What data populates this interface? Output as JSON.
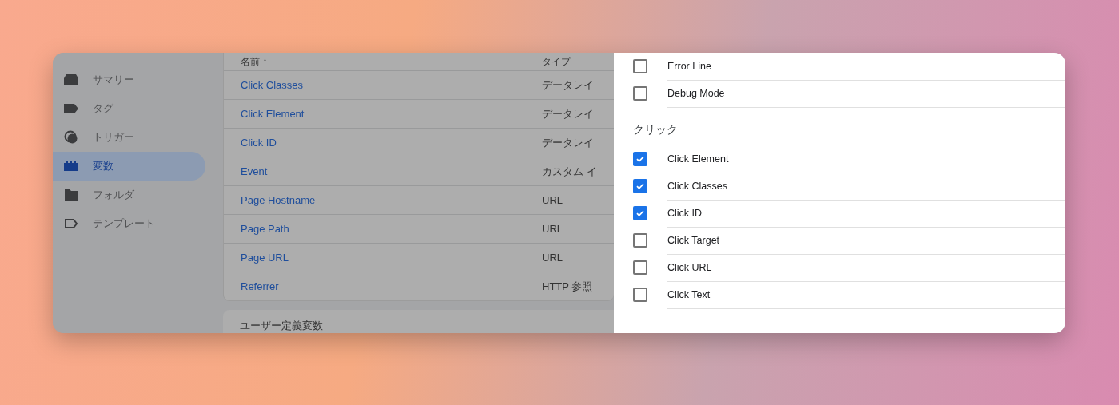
{
  "sidebar": {
    "items": [
      {
        "label": "サマリー",
        "selected": false
      },
      {
        "label": "タグ",
        "selected": false
      },
      {
        "label": "トリガー",
        "selected": false
      },
      {
        "label": "変数",
        "selected": true
      },
      {
        "label": "フォルダ",
        "selected": false
      },
      {
        "label": "テンプレート",
        "selected": false
      }
    ]
  },
  "table": {
    "columns": [
      {
        "label": "名前",
        "sort_indicator": "↑"
      },
      {
        "label": "タイプ"
      }
    ],
    "rows": [
      {
        "name": "Click Classes",
        "type": "データレイ"
      },
      {
        "name": "Click Element",
        "type": "データレイ"
      },
      {
        "name": "Click ID",
        "type": "データレイ"
      },
      {
        "name": "Event",
        "type": "カスタム イ"
      },
      {
        "name": "Page Hostname",
        "type": "URL"
      },
      {
        "name": "Page Path",
        "type": "URL"
      },
      {
        "name": "Page URL",
        "type": "URL"
      },
      {
        "name": "Referrer",
        "type": "HTTP 参照"
      }
    ]
  },
  "user_defined": {
    "title": "ユーザー定義変数"
  },
  "drawer": {
    "items": [
      {
        "kind": "checkbox",
        "label": "Error Line",
        "checked": false
      },
      {
        "kind": "checkbox",
        "label": "Debug Mode",
        "checked": false
      },
      {
        "kind": "heading",
        "label": "クリック"
      },
      {
        "kind": "checkbox",
        "label": "Click Element",
        "checked": true
      },
      {
        "kind": "checkbox",
        "label": "Click Classes",
        "checked": true
      },
      {
        "kind": "checkbox",
        "label": "Click ID",
        "checked": true
      },
      {
        "kind": "checkbox",
        "label": "Click Target",
        "checked": false
      },
      {
        "kind": "checkbox",
        "label": "Click URL",
        "checked": false
      },
      {
        "kind": "checkbox",
        "label": "Click Text",
        "checked": false
      }
    ]
  }
}
